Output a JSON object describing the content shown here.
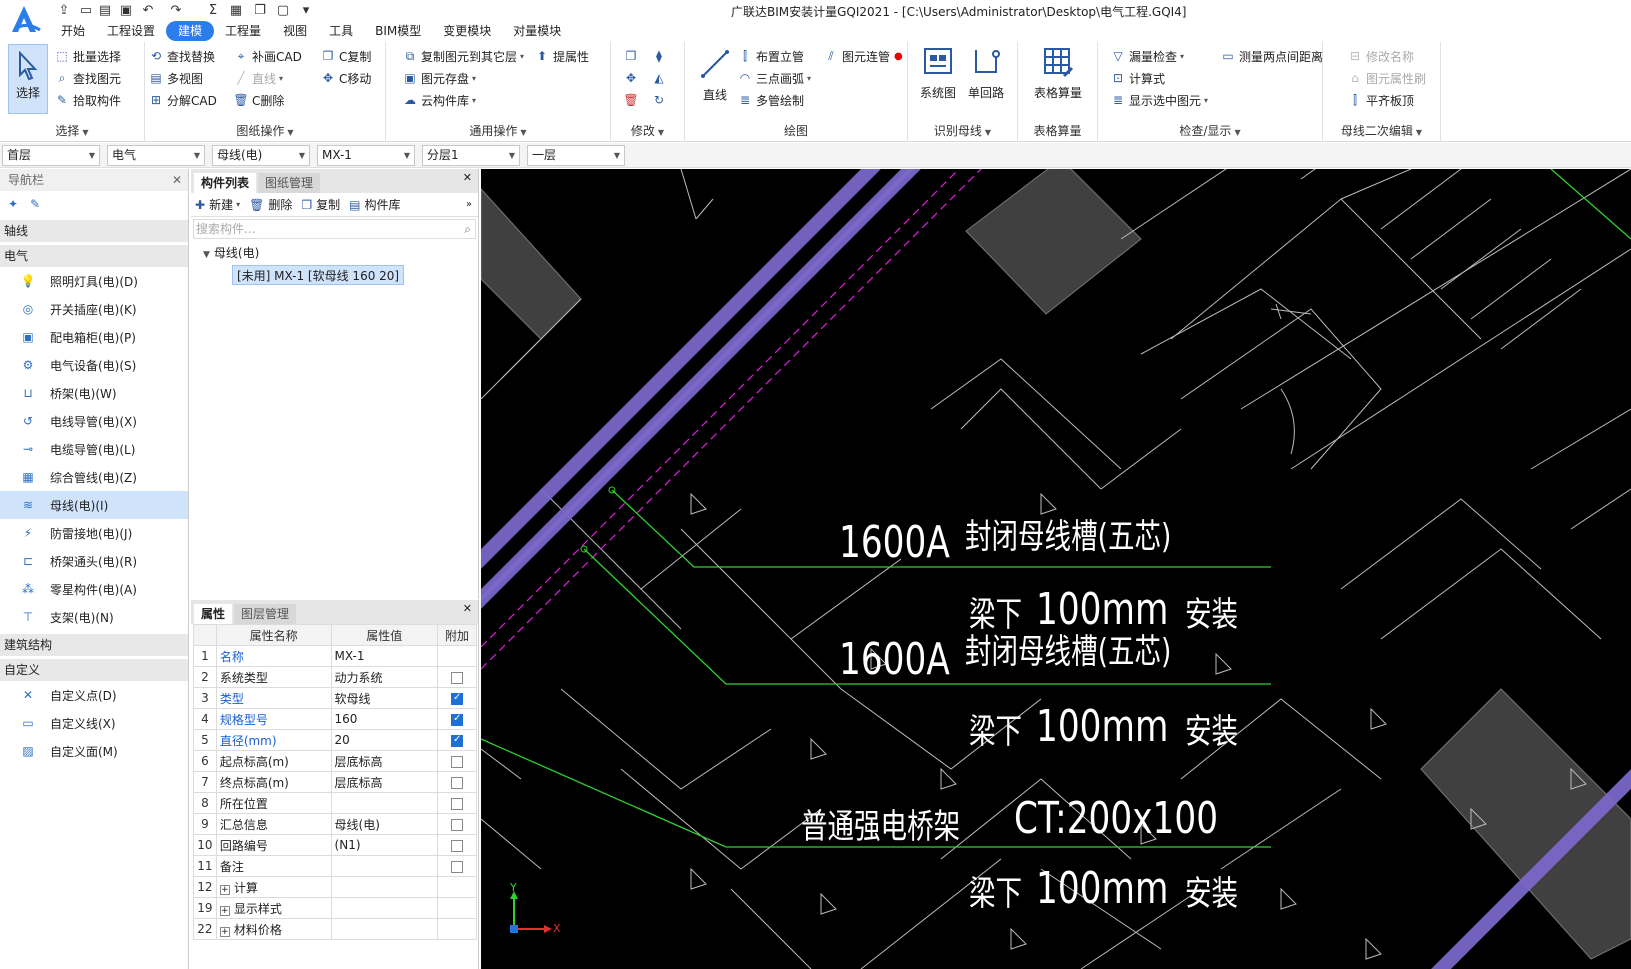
{
  "app": {
    "title": "广联达BIM安装计量GQI2021 - [C:\\Users\\Administrator\\Desktop\\电气工程.GQI4]"
  },
  "menu_tabs": [
    "开始",
    "工程设置",
    "建模",
    "工程量",
    "视图",
    "工具",
    "BIM模型",
    "变更模块",
    "对量模块"
  ],
  "ribbon": {
    "select": {
      "label": "选择",
      "group": "选择"
    },
    "select_group": [
      "批量选择",
      "查找图元",
      "拾取构件"
    ],
    "drawing_ops": {
      "group": "图纸操作",
      "items": [
        "查找替换",
        "多视图",
        "分解CAD",
        "补画CAD",
        "直线",
        "C删除",
        "C复制",
        "C移动"
      ]
    },
    "common_ops": {
      "group": "通用操作",
      "items": [
        "复制图元到其它层",
        "提属性",
        "图元存盘",
        "云构件库"
      ]
    },
    "modify": {
      "group": "修改"
    },
    "draw": {
      "group": "绘图",
      "big": "直线",
      "items": [
        "布置立管",
        "图元连管",
        "三点画弧",
        "多管绘制"
      ]
    },
    "identify": {
      "group": "识别母线",
      "items": [
        "系统图",
        "单回路"
      ]
    },
    "table_calc": {
      "group": "表格算量",
      "items": [
        "表格算量"
      ]
    },
    "check": {
      "group": "检查/显示",
      "items": [
        "漏量检查",
        "测量两点间距离",
        "计算式",
        "显示选中图元"
      ]
    },
    "busbar_edit": {
      "group": "母线二次编辑",
      "items": [
        "修改名称",
        "图元属性刷",
        "平齐板顶"
      ]
    }
  },
  "combos": [
    "首层",
    "电气",
    "母线(电)",
    "MX-1",
    "分层1",
    "一层"
  ],
  "nav": {
    "header": "导航栏",
    "cat_axis": "轴线",
    "cat_electric": "电气",
    "items": [
      {
        "label": "照明灯具(电)(D)",
        "icon": "lamp-icon"
      },
      {
        "label": "开关插座(电)(K)",
        "icon": "switch-socket-icon"
      },
      {
        "label": "配电箱柜(电)(P)",
        "icon": "distribution-box-icon"
      },
      {
        "label": "电气设备(电)(S)",
        "icon": "electrical-equipment-icon"
      },
      {
        "label": "桥架(电)(W)",
        "icon": "cable-tray-icon"
      },
      {
        "label": "电线导管(电)(X)",
        "icon": "wire-conduit-icon"
      },
      {
        "label": "电缆导管(电)(L)",
        "icon": "cable-conduit-icon"
      },
      {
        "label": "综合管线(电)(Z)",
        "icon": "composite-pipeline-icon"
      },
      {
        "label": "母线(电)(I)",
        "icon": "busbar-icon"
      },
      {
        "label": "防雷接地(电)(J)",
        "icon": "lightning-ground-icon"
      },
      {
        "label": "桥架通头(电)(R)",
        "icon": "tray-fitting-icon"
      },
      {
        "label": "零星构件(电)(A)",
        "icon": "misc-component-icon"
      },
      {
        "label": "支架(电)(N)",
        "icon": "bracket-icon"
      }
    ],
    "cat_structure": "建筑结构",
    "cat_custom": "自定义",
    "custom_items": [
      {
        "label": "自定义点(D)",
        "icon": "custom-point-icon"
      },
      {
        "label": "自定义线(X)",
        "icon": "custom-line-icon"
      },
      {
        "label": "自定义面(M)",
        "icon": "custom-area-icon"
      }
    ]
  },
  "component_panel": {
    "tabs": [
      "构件列表",
      "图纸管理"
    ],
    "toolbar": [
      "新建",
      "删除",
      "复制",
      "构件库"
    ],
    "search_placeholder": "搜索构件...",
    "tree_root": "母线(电)",
    "tree_item": "[未用] MX-1 [软母线 160 20]"
  },
  "properties_panel": {
    "tabs": [
      "属性",
      "图层管理"
    ],
    "columns": [
      "属性名称",
      "属性值",
      "附加"
    ],
    "rows": [
      {
        "n": "1",
        "name": "名称",
        "value": "MX-1",
        "blue": true,
        "check": null
      },
      {
        "n": "2",
        "name": "系统类型",
        "value": "动力系统",
        "blue": false,
        "check": false
      },
      {
        "n": "3",
        "name": "类型",
        "value": "软母线",
        "blue": true,
        "check": true
      },
      {
        "n": "4",
        "name": "规格型号",
        "value": "160",
        "blue": true,
        "check": true
      },
      {
        "n": "5",
        "name": "直径(mm)",
        "value": "20",
        "blue": true,
        "check": true
      },
      {
        "n": "6",
        "name": "起点标高(m)",
        "value": "层底标高",
        "blue": false,
        "check": false
      },
      {
        "n": "7",
        "name": "终点标高(m)",
        "value": "层底标高",
        "blue": false,
        "check": false
      },
      {
        "n": "8",
        "name": "所在位置",
        "value": "",
        "blue": false,
        "check": false
      },
      {
        "n": "9",
        "name": "汇总信息",
        "value": "母线(电)",
        "blue": false,
        "check": false
      },
      {
        "n": "10",
        "name": "回路编号",
        "value": "(N1)",
        "blue": false,
        "check": false
      },
      {
        "n": "11",
        "name": "备注",
        "value": "",
        "blue": false,
        "check": false
      }
    ],
    "groups": [
      {
        "n": "12",
        "name": "计算"
      },
      {
        "n": "19",
        "name": "显示样式"
      },
      {
        "n": "22",
        "name": "材料价格"
      }
    ]
  },
  "cad": {
    "texts": {
      "t1": "1600A",
      "t2": "封闭母线槽(五芯)",
      "t3": "梁下",
      "t4": "100mm",
      "t5": "安装",
      "t6": "普通强电桥架",
      "t7": "CT:200x100"
    },
    "axis_x": "X",
    "axis_y": "Y"
  }
}
